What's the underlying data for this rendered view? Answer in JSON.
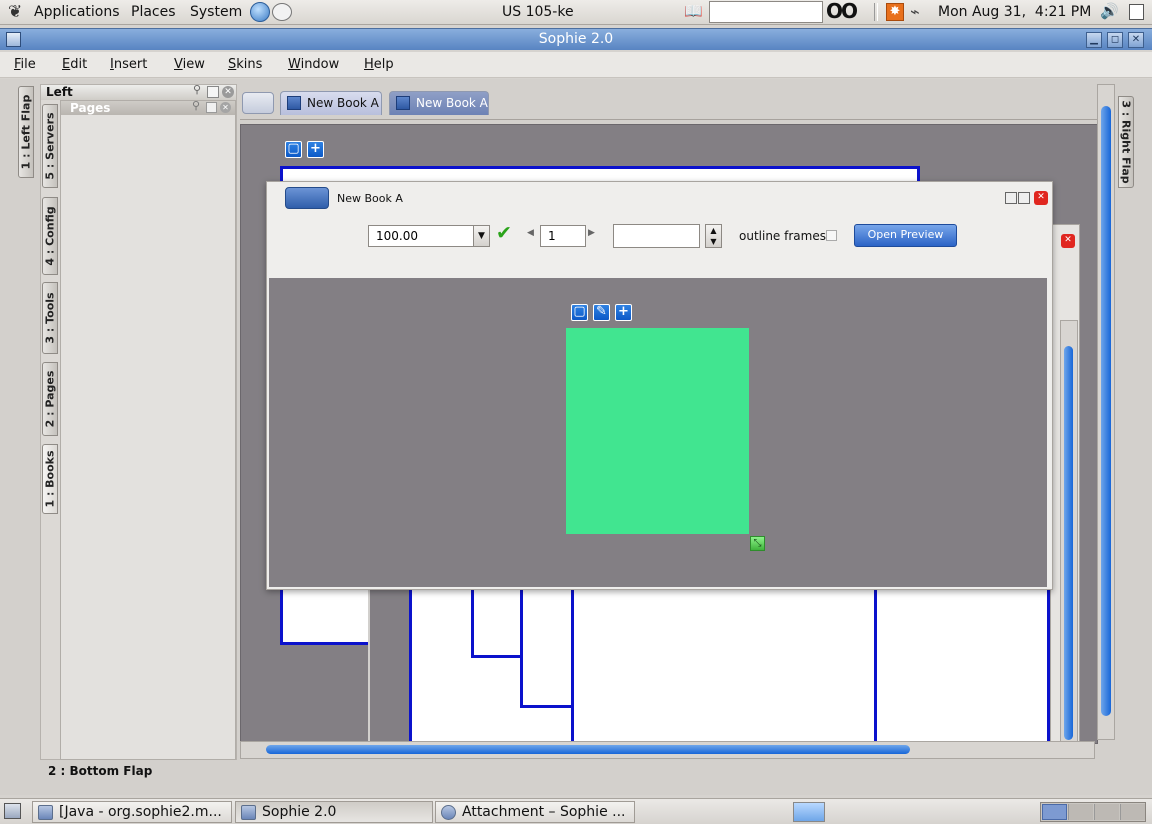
{
  "top_panel": {
    "menus": [
      "Applications",
      "Places",
      "System"
    ],
    "keyboard_layout": "US 105-ke",
    "search_value": "",
    "clock": "Mon Aug 31,  4:21 PM",
    "icons": [
      "gnome-foot-icon",
      "globe-icon",
      "mail-icon",
      "dictionary-icon",
      "eyes-icon",
      "update-alert-icon",
      "network-icon",
      "volume-icon",
      "clipboard-icon"
    ]
  },
  "window": {
    "title": "Sophie 2.0",
    "controls": [
      "minimize",
      "maximize",
      "close"
    ]
  },
  "menubar": {
    "items": [
      {
        "label": "File",
        "key": "F",
        "rest": "ile"
      },
      {
        "label": "Edit",
        "key": "E",
        "rest": "dit"
      },
      {
        "label": "Insert",
        "key": "I",
        "rest": "nsert"
      },
      {
        "label": "View",
        "key": "V",
        "rest": "iew"
      },
      {
        "label": "Skins",
        "key": "S",
        "rest": "kins"
      },
      {
        "label": "Window",
        "key": "W",
        "rest": "indow"
      },
      {
        "label": "Help",
        "key": "H",
        "rest": "elp"
      }
    ]
  },
  "left_flap": {
    "title": "Left",
    "panel_title": "Pages",
    "vertical_tabs": [
      "5 : Servers",
      "4 : Config",
      "3 : Tools",
      "2 : Pages",
      "1 : Books"
    ],
    "outer_tab": "1 : Left Flap"
  },
  "right_flap": {
    "tab": "3 : Right Flap"
  },
  "bottom_flap": {
    "label": "2 : Bottom Flap"
  },
  "doc_tabs": [
    "New Book A",
    "New Book A"
  ],
  "book_window": {
    "title": "New Book A",
    "zoom_value": "100.00",
    "page_value": "1",
    "extra_value": "",
    "outline_label": "outline frames",
    "outline_checked": false,
    "preview_button": "Open Preview"
  },
  "frame": {
    "color": "#41e590"
  },
  "taskbar": {
    "items": [
      "[Java - org.sophie2.m...",
      "Sophie 2.0",
      "Attachment – Sophie ..."
    ]
  }
}
